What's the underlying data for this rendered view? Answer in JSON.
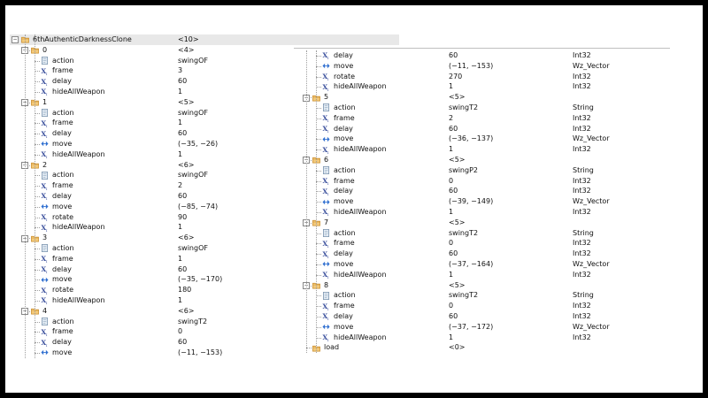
{
  "left_tree": {
    "rows": [
      {
        "indent": 0,
        "kind": "folder",
        "toggle": "-",
        "name": "6thAuthenticDarknessClone",
        "value": "<10>",
        "type": ""
      },
      {
        "indent": 1,
        "kind": "folder",
        "toggle": "-",
        "name": "0",
        "value": "<4>",
        "type": ""
      },
      {
        "indent": 2,
        "kind": "string",
        "name": "action",
        "value": "swingOF",
        "type": ""
      },
      {
        "indent": 2,
        "kind": "int",
        "name": "frame",
        "value": "3",
        "type": ""
      },
      {
        "indent": 2,
        "kind": "int",
        "name": "delay",
        "value": "60",
        "type": ""
      },
      {
        "indent": 2,
        "kind": "int",
        "name": "hideAllWeapon",
        "value": "1",
        "type": ""
      },
      {
        "indent": 1,
        "kind": "folder",
        "toggle": "-",
        "name": "1",
        "value": "<5>",
        "type": ""
      },
      {
        "indent": 2,
        "kind": "string",
        "name": "action",
        "value": "swingOF",
        "type": ""
      },
      {
        "indent": 2,
        "kind": "int",
        "name": "frame",
        "value": "1",
        "type": ""
      },
      {
        "indent": 2,
        "kind": "int",
        "name": "delay",
        "value": "60",
        "type": ""
      },
      {
        "indent": 2,
        "kind": "vector",
        "name": "move",
        "value": "(−35, −26)",
        "type": ""
      },
      {
        "indent": 2,
        "kind": "int",
        "name": "hideAllWeapon",
        "value": "1",
        "type": ""
      },
      {
        "indent": 1,
        "kind": "folder",
        "toggle": "-",
        "name": "2",
        "value": "<6>",
        "type": ""
      },
      {
        "indent": 2,
        "kind": "string",
        "name": "action",
        "value": "swingOF",
        "type": ""
      },
      {
        "indent": 2,
        "kind": "int",
        "name": "frame",
        "value": "2",
        "type": ""
      },
      {
        "indent": 2,
        "kind": "int",
        "name": "delay",
        "value": "60",
        "type": ""
      },
      {
        "indent": 2,
        "kind": "vector",
        "name": "move",
        "value": "(−85, −74)",
        "type": ""
      },
      {
        "indent": 2,
        "kind": "int",
        "name": "rotate",
        "value": "90",
        "type": ""
      },
      {
        "indent": 2,
        "kind": "int",
        "name": "hideAllWeapon",
        "value": "1",
        "type": ""
      },
      {
        "indent": 1,
        "kind": "folder",
        "toggle": "-",
        "name": "3",
        "value": "<6>",
        "type": ""
      },
      {
        "indent": 2,
        "kind": "string",
        "name": "action",
        "value": "swingOF",
        "type": ""
      },
      {
        "indent": 2,
        "kind": "int",
        "name": "frame",
        "value": "1",
        "type": ""
      },
      {
        "indent": 2,
        "kind": "int",
        "name": "delay",
        "value": "60",
        "type": ""
      },
      {
        "indent": 2,
        "kind": "vector",
        "name": "move",
        "value": "(−35, −170)",
        "type": ""
      },
      {
        "indent": 2,
        "kind": "int",
        "name": "rotate",
        "value": "180",
        "type": ""
      },
      {
        "indent": 2,
        "kind": "int",
        "name": "hideAllWeapon",
        "value": "1",
        "type": ""
      },
      {
        "indent": 1,
        "kind": "folder",
        "toggle": "-",
        "name": "4",
        "value": "<6>",
        "type": ""
      },
      {
        "indent": 2,
        "kind": "string",
        "name": "action",
        "value": "swingT2",
        "type": ""
      },
      {
        "indent": 2,
        "kind": "int",
        "name": "frame",
        "value": "0",
        "type": ""
      },
      {
        "indent": 2,
        "kind": "int",
        "name": "delay",
        "value": "60",
        "type": ""
      },
      {
        "indent": 2,
        "kind": "vector",
        "name": "move",
        "value": "(−11, −153)",
        "type": ""
      }
    ]
  },
  "right_tree": {
    "rows": [
      {
        "indent": 2,
        "kind": "int",
        "name": "delay",
        "value": "60",
        "type": "Int32"
      },
      {
        "indent": 2,
        "kind": "vector",
        "name": "move",
        "value": "(−11, −153)",
        "type": "Wz_Vector"
      },
      {
        "indent": 2,
        "kind": "int",
        "name": "rotate",
        "value": "270",
        "type": "Int32"
      },
      {
        "indent": 2,
        "kind": "int",
        "name": "hideAllWeapon",
        "value": "1",
        "type": "Int32"
      },
      {
        "indent": 1,
        "kind": "folder",
        "toggle": "-",
        "name": "5",
        "value": "<5>",
        "type": ""
      },
      {
        "indent": 2,
        "kind": "string",
        "name": "action",
        "value": "swingT2",
        "type": "String"
      },
      {
        "indent": 2,
        "kind": "int",
        "name": "frame",
        "value": "2",
        "type": "Int32"
      },
      {
        "indent": 2,
        "kind": "int",
        "name": "delay",
        "value": "60",
        "type": "Int32"
      },
      {
        "indent": 2,
        "kind": "vector",
        "name": "move",
        "value": "(−36, −137)",
        "type": "Wz_Vector"
      },
      {
        "indent": 2,
        "kind": "int",
        "name": "hideAllWeapon",
        "value": "1",
        "type": "Int32"
      },
      {
        "indent": 1,
        "kind": "folder",
        "toggle": "-",
        "name": "6",
        "value": "<5>",
        "type": ""
      },
      {
        "indent": 2,
        "kind": "string",
        "name": "action",
        "value": "swingP2",
        "type": "String"
      },
      {
        "indent": 2,
        "kind": "int",
        "name": "frame",
        "value": "0",
        "type": "Int32"
      },
      {
        "indent": 2,
        "kind": "int",
        "name": "delay",
        "value": "60",
        "type": "Int32"
      },
      {
        "indent": 2,
        "kind": "vector",
        "name": "move",
        "value": "(−39, −149)",
        "type": "Wz_Vector"
      },
      {
        "indent": 2,
        "kind": "int",
        "name": "hideAllWeapon",
        "value": "1",
        "type": "Int32"
      },
      {
        "indent": 1,
        "kind": "folder",
        "toggle": "-",
        "name": "7",
        "value": "<5>",
        "type": ""
      },
      {
        "indent": 2,
        "kind": "string",
        "name": "action",
        "value": "swingT2",
        "type": "String"
      },
      {
        "indent": 2,
        "kind": "int",
        "name": "frame",
        "value": "0",
        "type": "Int32"
      },
      {
        "indent": 2,
        "kind": "int",
        "name": "delay",
        "value": "60",
        "type": "Int32"
      },
      {
        "indent": 2,
        "kind": "vector",
        "name": "move",
        "value": "(−37, −164)",
        "type": "Wz_Vector"
      },
      {
        "indent": 2,
        "kind": "int",
        "name": "hideAllWeapon",
        "value": "1",
        "type": "Int32"
      },
      {
        "indent": 1,
        "kind": "folder",
        "toggle": "-",
        "name": "8",
        "value": "<5>",
        "type": ""
      },
      {
        "indent": 2,
        "kind": "string",
        "name": "action",
        "value": "swingT2",
        "type": "String"
      },
      {
        "indent": 2,
        "kind": "int",
        "name": "frame",
        "value": "0",
        "type": "Int32"
      },
      {
        "indent": 2,
        "kind": "int",
        "name": "delay",
        "value": "60",
        "type": "Int32"
      },
      {
        "indent": 2,
        "kind": "vector",
        "name": "move",
        "value": "(−37, −172)",
        "type": "Wz_Vector"
      },
      {
        "indent": 2,
        "kind": "int",
        "name": "hideAllWeapon",
        "value": "1",
        "type": "Int32"
      },
      {
        "indent": 1,
        "kind": "folder",
        "toggle": "",
        "name": "load",
        "value": "<0>",
        "type": ""
      }
    ]
  },
  "icon_glyphs": {
    "int_label": "X",
    "int_sub": "I"
  },
  "colors": {
    "folder_fill": "#f3c97a",
    "folder_edge": "#c98c2a",
    "string_fill": "#e6eef6",
    "string_edge": "#6f8aa6",
    "int_color": "#3a4f9c",
    "vector_color": "#2f6fd0",
    "selection": "#e8e8e8"
  }
}
